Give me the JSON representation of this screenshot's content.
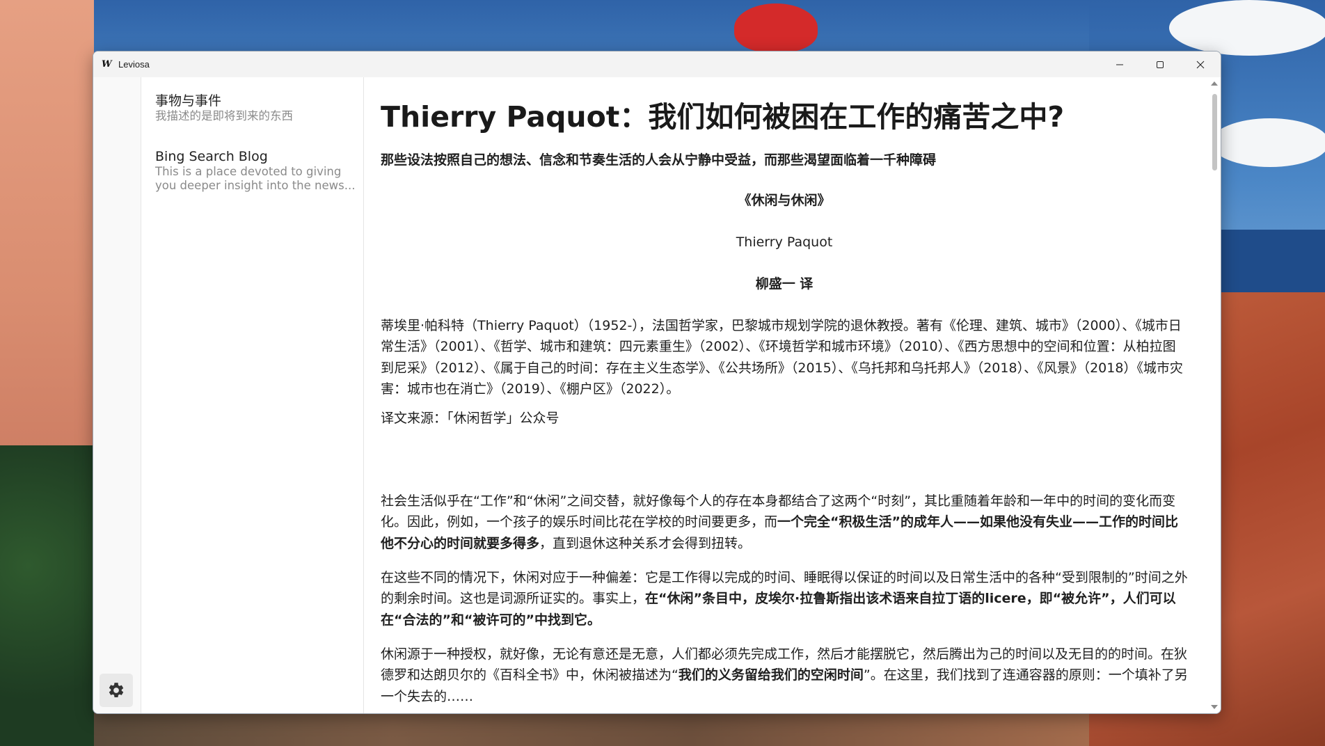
{
  "window": {
    "app_title": "Leviosa",
    "app_icon": "W"
  },
  "feeds": [
    {
      "title": "事物与事件",
      "description": "我描述的是即将到来的东西"
    },
    {
      "title": "Bing Search Blog",
      "description": "This is a place devoted to giving you deeper insight into the news..."
    }
  ],
  "rail": {
    "settings_icon": "gear-icon"
  },
  "article": {
    "title": "Thierry Paquot：我们如何被困在工作的痛苦之中?",
    "subtitle": "那些设法按照自己的想法、信念和节奏生活的人会从宁静中受益，而那些渴望面临着一千种障碍",
    "book_title": "《休闲与休闲》",
    "author": "Thierry Paquot",
    "translator": "柳盛一 译",
    "bio": "蒂埃里·帕科特（Thierry Paquot）（1952-），法国哲学家，巴黎城市规划学院的退休教授。著有《伦理、建筑、城市》（2000）、《城市日常生活》（2001）、《哲学、城市和建筑：四元素重生》（2002）、《环境哲学和城市环境》（2010）、《西方思想中的空间和位置：从柏拉图到尼采》（2012）、《属于自己的时间：存在主义生态学》、《公共场所》（2015）、《乌托邦和乌托邦人》（2018）、《风景》（2018）《城市灾害：城市也在消亡》（2019）、《棚户区》（2022）。",
    "source": "译文来源：「休闲哲学」公众号",
    "p1_a": "社会生活似乎在“工作”和“休闲”之间交替，就好像每个人的存在本身都结合了这两个“时刻”，其比重随着年龄和一年中的时间的变化而变化。因此，例如，一个孩子的娱乐时间比花在学校的时间要更多，而",
    "p1_b": "一个完全“积极生活”的成年人——如果他没有失业——工作的时间比他不分心的时间就要多得多",
    "p1_c": "，直到退休这种关系才会得到扭转。",
    "p2_a": "在这些不同的情况下，休闲对应于一种偏差：它是工作得以完成的时间、睡眠得以保证的时间以及日常生活中的各种“受到限制的”时间之外的剩余时间。这也是词源所证实的。事实上，",
    "p2_b": "在“休闲”条目中，皮埃尔·拉鲁斯指出该术语来自拉丁语的licere，即“被允许”，人们可以在“合法的”和“被许可的”中找到它。",
    "p3_a": "休闲源于一种授权，就好像，无论有意还是无意，人们都必须先完成工作，然后才能摆脱它，然后腾出为己的时间以及无目的的时间。在狄德罗和达朗贝尔的《百科全书》中，休闲被描述为“",
    "p3_b": "我们的义务留给我们的空闲时间",
    "p3_c": "”。在这里，我们找到了连通容器的原则：一个填补了另一个失去的……"
  }
}
